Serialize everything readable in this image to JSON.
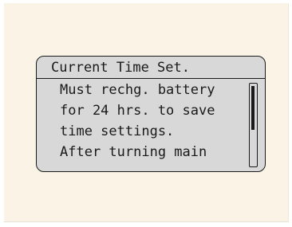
{
  "screen": {
    "title": "Current Time Set.",
    "lines": [
      "Must rechg. battery",
      "for 24 hrs. to save",
      "time settings.",
      "After turning main"
    ],
    "scroll_position": 0
  },
  "colors": {
    "background": "#fbf3e6",
    "lcd_background": "#d8d8d8",
    "lcd_text": "#1a1a1a"
  }
}
